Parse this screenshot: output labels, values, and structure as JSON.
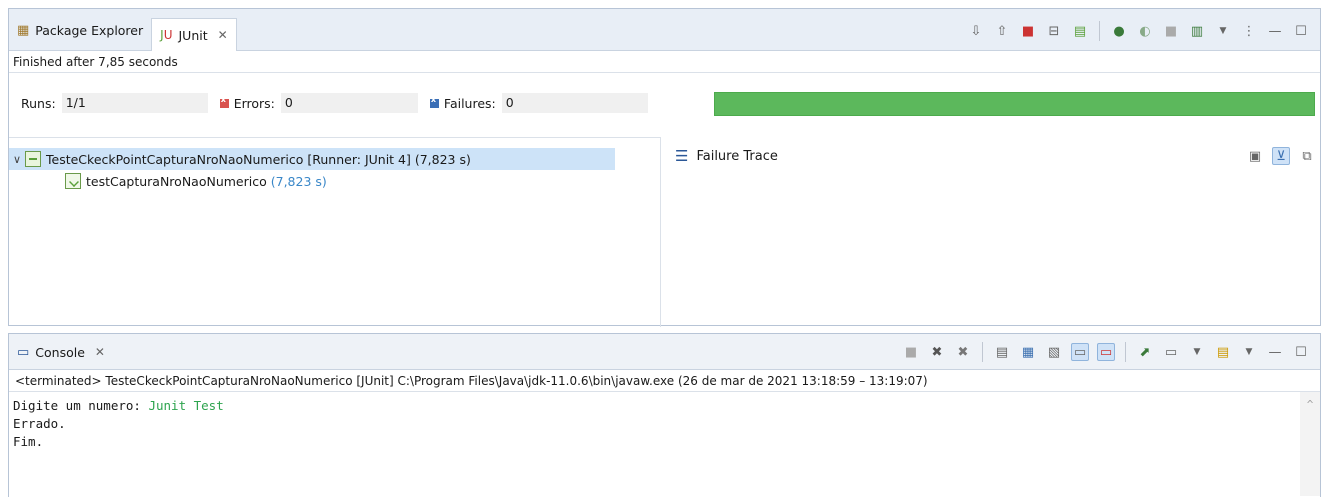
{
  "junit_view": {
    "tabs": [
      {
        "label": "Package Explorer"
      },
      {
        "label": "JUnit"
      }
    ],
    "status": "Finished after 7,85 seconds",
    "runs_label": "Runs:",
    "runs_value": "1/1",
    "errors_label": "Errors:",
    "errors_value": "0",
    "failures_label": "Failures:",
    "failures_value": "0",
    "progress_fraction": 1.0,
    "progress_color": "#5cb85c",
    "tree": {
      "suite_label": "TesteCkeckPointCapturaNroNaoNumerico [Runner: JUnit 4] (7,823 s)",
      "test_name": "testCapturaNroNaoNumerico",
      "test_time": "(7,823 s)"
    },
    "failure_trace_title": "Failure Trace",
    "toolbar_icons": [
      "next-failure-icon",
      "previous-failure-icon",
      "show-failures-only-icon",
      "scroll-lock-icon",
      "show-skipped-icon",
      "rerun-test-icon",
      "rerun-failed-first-icon",
      "stop-icon",
      "test-run-history-icon",
      "view-menu-icon",
      "minimize-icon",
      "maximize-icon"
    ]
  },
  "console_view": {
    "tab_label": "Console",
    "info": "<terminated> TesteCkeckPointCapturaNroNaoNumerico [JUnit] C:\\Program Files\\Java\\jdk-11.0.6\\bin\\javaw.exe  (26 de mar de 2021 13:18:59 – 13:19:07)",
    "lines": [
      {
        "prompt": "Digite um numero: ",
        "input": "Junit Test"
      },
      {
        "prompt": "Errado.",
        "input": ""
      },
      {
        "prompt": "Fim.",
        "input": ""
      }
    ]
  }
}
